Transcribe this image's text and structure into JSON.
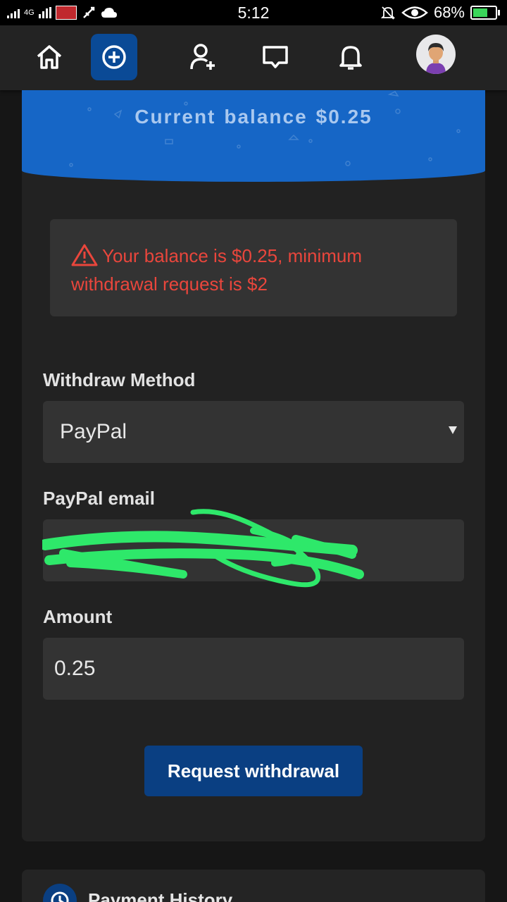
{
  "status_bar": {
    "time": "5:12",
    "network": "4G",
    "battery_percent": "68%",
    "battery_level": 0.68,
    "icons": [
      "signal-icon",
      "flag-icon",
      "usb-icon",
      "cloud-icon",
      "mute-icon",
      "eye-icon",
      "battery-icon"
    ]
  },
  "nav": {
    "items": [
      "home-icon",
      "add-circle-icon",
      "add-user-icon",
      "chat-icon",
      "bell-icon",
      "avatar"
    ],
    "active": "add-circle-icon"
  },
  "banner": {
    "label_word1": "Current",
    "label_word2": "balance",
    "amount": "$0.25"
  },
  "alert": {
    "message": "Your balance is $0.25, minimum withdrawal request is $2",
    "icon": "warning-icon"
  },
  "form": {
    "method_label": "Withdraw Method",
    "method_value": "PayPal",
    "email_label": "PayPal email",
    "amount_label": "Amount",
    "amount_value": "0.25"
  },
  "button": {
    "request_label": "Request withdrawal"
  },
  "history": {
    "title": "Payment History",
    "icon": "history-icon"
  },
  "colors": {
    "accent": "#0a3f82",
    "banner": "#1666c6",
    "error": "#e9463c",
    "background": "#161616",
    "card": "#222222"
  }
}
